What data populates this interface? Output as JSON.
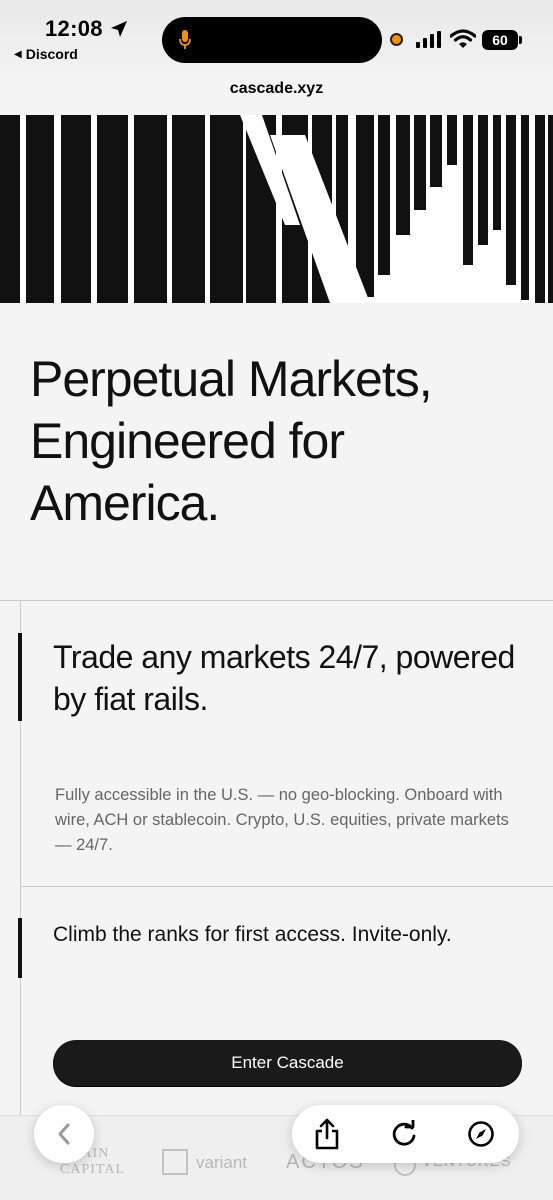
{
  "status_bar": {
    "time": "12:08",
    "back_app_label": "Discord",
    "battery": "60",
    "url": "cascade.xyz",
    "colors": {
      "recording_dot": "#f29200",
      "mic": "#f29200"
    }
  },
  "hero": {
    "headline": "Perpetual Markets, Engineered for America."
  },
  "section": {
    "subhead": "Trade any markets 24/7, powered by fiat rails.",
    "body": "Fully accessible in the U.S. — no geo-blocking. Onboard with wire, ACH or stablecoin. Crypto, U.S. equities, private markets — 24/7.",
    "invite": "Climb the ranks for first access. Invite-only.",
    "cta_label": "Enter Cascade"
  },
  "partners": {
    "chain_capital": "CHAIN\nCAPITAL",
    "variant": "variant",
    "actos": "ACTOS",
    "ventures": "VENTURES"
  },
  "toolbar": {
    "icons": [
      "chevron-left-icon",
      "share-icon",
      "reload-icon",
      "compass-icon"
    ]
  }
}
